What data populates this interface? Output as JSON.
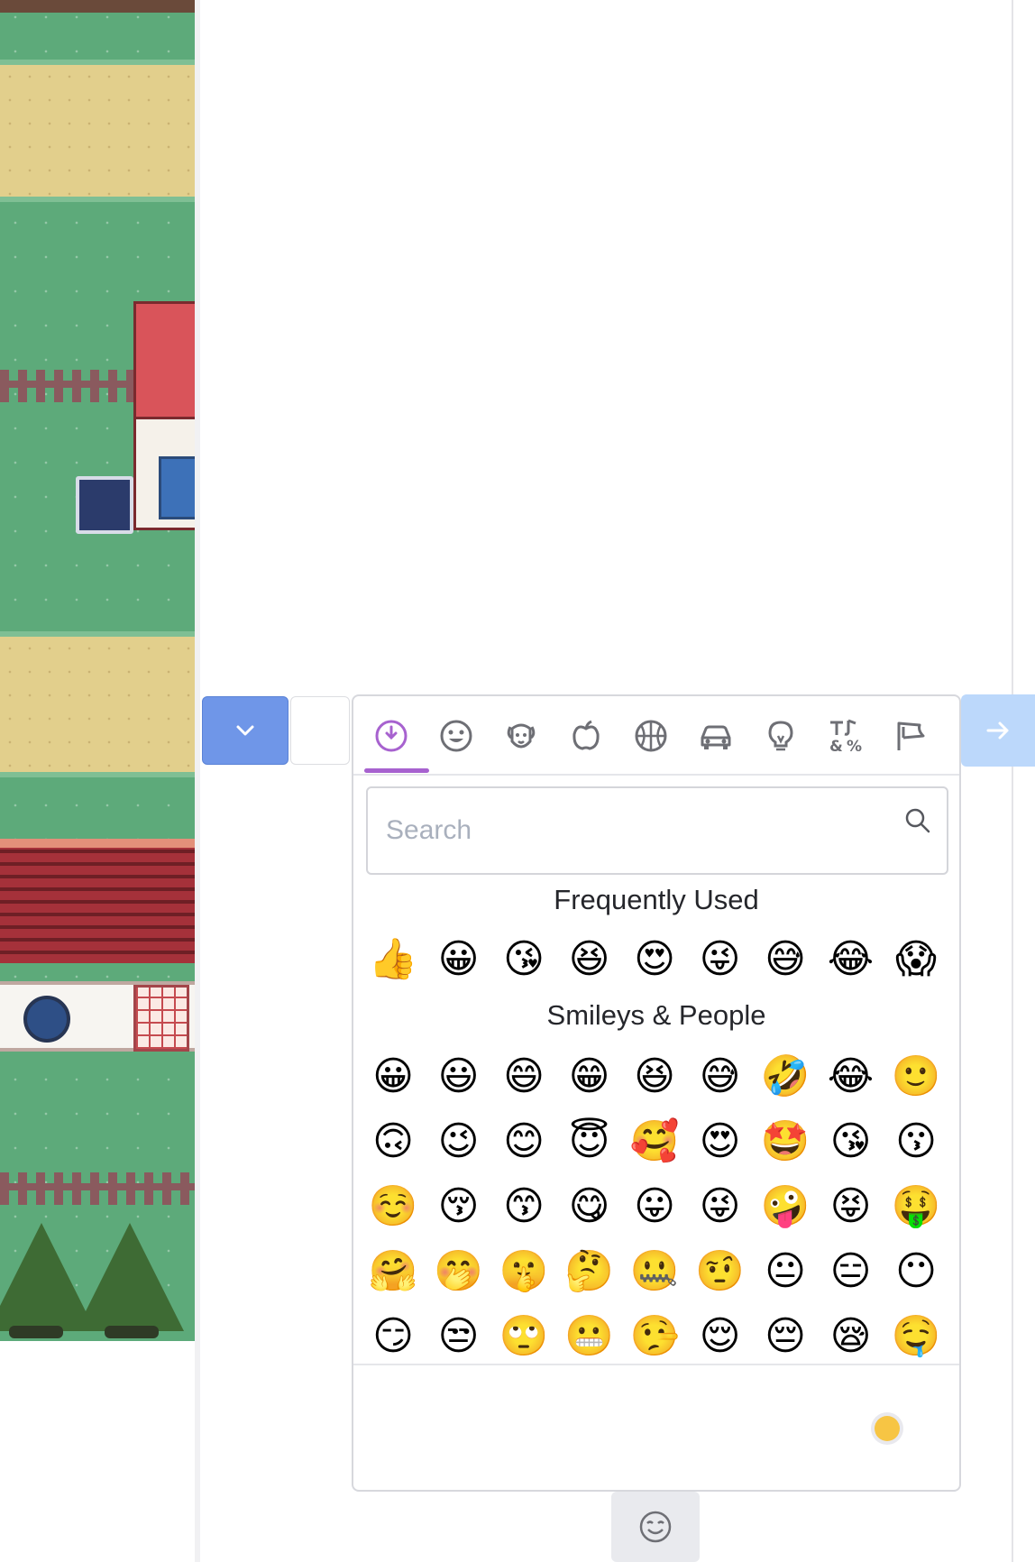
{
  "colors": {
    "accent": "#a762cf",
    "primary_button": "#6f96e8",
    "send_button": "#bcd8fb",
    "skin_tone": "#f7c544"
  },
  "picker": {
    "tabs": [
      {
        "name": "recent",
        "icon": "clock-icon",
        "active": true
      },
      {
        "name": "smileys",
        "icon": "smiley-icon"
      },
      {
        "name": "animals",
        "icon": "dog-icon"
      },
      {
        "name": "food",
        "icon": "apple-icon"
      },
      {
        "name": "activities",
        "icon": "basketball-icon"
      },
      {
        "name": "travel",
        "icon": "car-icon"
      },
      {
        "name": "objects",
        "icon": "lightbulb-icon"
      },
      {
        "name": "symbols",
        "icon": "symbols-icon"
      },
      {
        "name": "flags",
        "icon": "flag-icon"
      }
    ],
    "search_placeholder": "Search",
    "frequently_used_title": "Frequently Used",
    "frequently_used": [
      "👍",
      "😀",
      "😘",
      "😆",
      "😍",
      "😜",
      "😅",
      "😂",
      "😱"
    ],
    "smileys_title": "Smileys & People",
    "smileys_rows": [
      [
        "😀",
        "😃",
        "😄",
        "😁",
        "😆",
        "😅",
        "🤣",
        "😂",
        "🙂"
      ],
      [
        "🙃",
        "😉",
        "😊",
        "😇",
        "🥰",
        "😍",
        "🤩",
        "😘",
        "😗"
      ],
      [
        "☺️",
        "😚",
        "😙",
        "😋",
        "😛",
        "😜",
        "🤪",
        "😝",
        "🤑"
      ],
      [
        "🤗",
        "🤭",
        "🤫",
        "🤔",
        "🤐",
        "🤨",
        "😐",
        "😑",
        "😶"
      ],
      [
        "😏",
        "😒",
        "🙄",
        "😬",
        "🤥",
        "😌",
        "😔",
        "😪",
        "🤤"
      ]
    ]
  }
}
